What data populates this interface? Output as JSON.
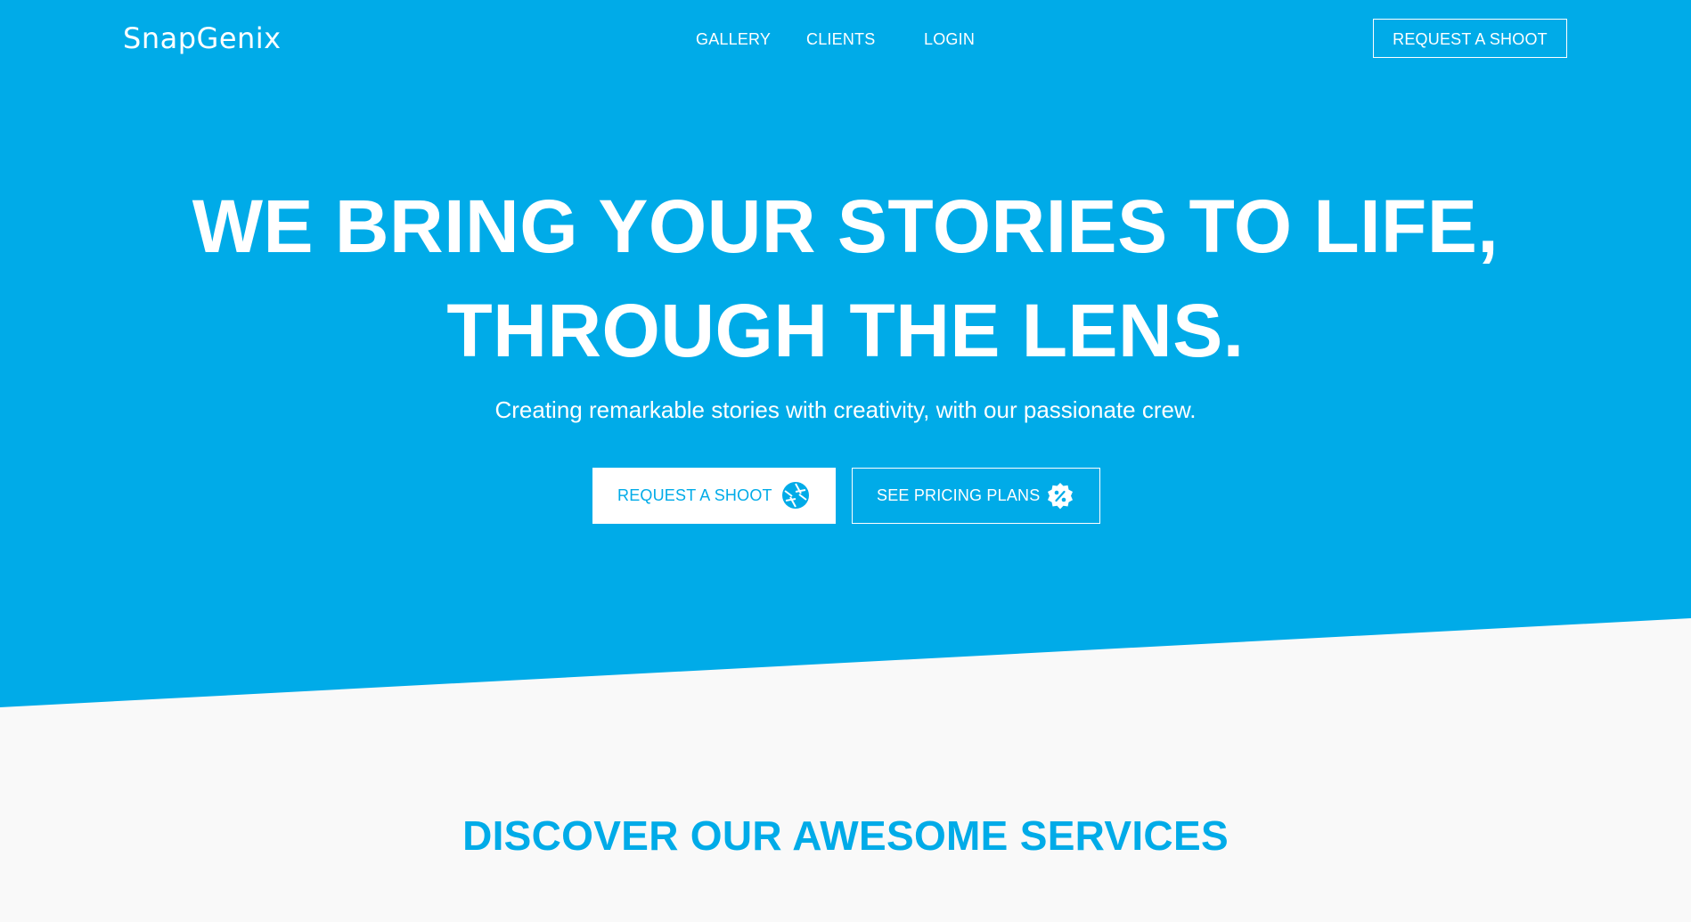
{
  "header": {
    "logo_text": "SnapGenix",
    "nav": [
      {
        "label": "GALLERY"
      },
      {
        "label": "CLIENTS"
      },
      {
        "label": "LOGIN"
      }
    ],
    "cta_label": "REQUEST A SHOOT"
  },
  "hero": {
    "headline_line1": "WE BRING YOUR STORIES TO LIFE,",
    "headline_line2": "THROUGH THE LENS.",
    "subtitle": "Creating remarkable stories with creativity, with our passionate crew.",
    "primary_button": {
      "label": "REQUEST A SHOOT",
      "icon": "camera-aperture-icon"
    },
    "secondary_button": {
      "label": "SEE PRICING PLANS",
      "icon": "discount-badge-icon"
    }
  },
  "services": {
    "title": "DISCOVER OUR AWESOME SERVICES"
  },
  "colors": {
    "brand": "#00abe8",
    "background": "#f9f9f9",
    "logo_accent": "#ff4b2b"
  }
}
